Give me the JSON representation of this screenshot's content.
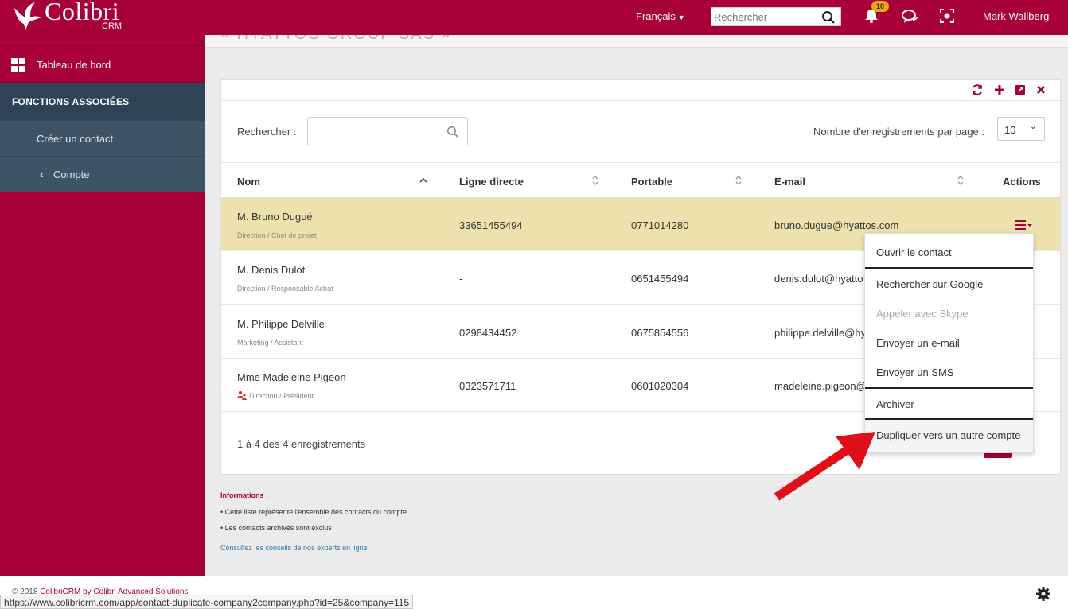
{
  "brand": {
    "name": "Colibri",
    "sub": "CRM"
  },
  "topbar": {
    "language": "Français",
    "search_placeholder": "Rechercher",
    "notifications_count": "10",
    "user": "Mark Wallberg"
  },
  "sidebar": {
    "dashboard": "Tableau de bord",
    "section": "FONCTIONS ASSOCIÉES",
    "items": [
      "Créer un contact",
      "Compte"
    ]
  },
  "page": {
    "title_fragment": "« HYATTOS GROUP SAS »"
  },
  "panel": {
    "search_label": "Rechercher :",
    "per_page_label": "Nombre d'enregistrements par page :",
    "per_page_value": "10",
    "columns": [
      "Nom",
      "Ligne directe",
      "Portable",
      "E-mail",
      "Actions"
    ],
    "rows": [
      {
        "name": "M. Bruno Dugué",
        "sub": "Direction / Chef de projet",
        "direct": "33651455494",
        "mobile": "0771014280",
        "email": "bruno.dugue@hyattos.com"
      },
      {
        "name": "M. Denis Dulot",
        "sub": "Direction / Responsable Achat",
        "direct": "-",
        "mobile": "0651455494",
        "email": "denis.dulot@hyatto"
      },
      {
        "name": "M. Philippe Delville",
        "sub": "Marketing / Assistant",
        "direct": "0298434452",
        "mobile": "0675854556",
        "email": "philippe.delville@hy"
      },
      {
        "name": "Mme Madeleine Pigeon",
        "sub": "Direction / Président",
        "direct": "0323571711",
        "mobile": "0601020304",
        "email": "madeleine.pigeon@"
      }
    ],
    "footer_count": "1 à 4 des 4 enregistrements"
  },
  "dropdown": {
    "items": [
      "Ouvrir le contact",
      "Rechercher sur Google",
      "Appeler avec Skype",
      "Envoyer un e-mail",
      "Envoyer un SMS",
      "Archiver",
      "Dupliquer vers un autre compte"
    ]
  },
  "info": {
    "title": "Informations :",
    "line1": "• Cette liste représente l'ensemble des contacts du compte",
    "line2": "• Les contacts archivés sont exclus",
    "link": "Consultez les conseils de nos experts en ligne"
  },
  "footer": {
    "copyright_prefix": "© 2018",
    "copyright_brand": "ColibriCRM by Colibri Advanced Solutions",
    "status_url": "https://www.colibricrm.com/app/contact-duplicate-company2company.php?id=25&company=115"
  },
  "colors": {
    "brand": "#a80038",
    "sidebar_dark": "#2e4356",
    "highlight_row": "#ede2ae",
    "arrow": "#e0101a"
  }
}
